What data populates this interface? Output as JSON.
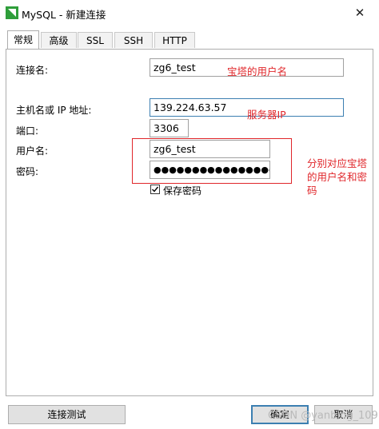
{
  "window": {
    "title": "MySQL - 新建连接",
    "close_glyph": "✕"
  },
  "tabs": [
    {
      "label": "常规",
      "active": true
    },
    {
      "label": "高级"
    },
    {
      "label": "SSL"
    },
    {
      "label": "SSH"
    },
    {
      "label": "HTTP"
    }
  ],
  "form": {
    "connection_name_label": "连接名:",
    "connection_name_value": "zg6_test",
    "host_label": "主机名或 IP 地址:",
    "host_value": "139.224.63.57",
    "port_label": "端口:",
    "port_value": "3306",
    "username_label": "用户名:",
    "username_value": "zg6_test",
    "password_label": "密码:",
    "password_value": "●●●●●●●●●●●●●●●●",
    "save_password_label": "保存密码",
    "save_password_checked": true
  },
  "annotations": {
    "connection_name_note": "宝塔的用户名",
    "host_note": "服务器IP",
    "credentials_note_line1": "分别对应宝塔",
    "credentials_note_line2": "的用户名和密",
    "credentials_note_line3": "码"
  },
  "buttons": {
    "test_connection": "连接测试",
    "ok": "确定",
    "cancel": "取消"
  },
  "watermark": "CSDN @yanbing_109",
  "colors": {
    "annotation_red": "#e0262a",
    "focus_blue": "#3c7fb1",
    "app_icon_green": "#2e9e3a"
  }
}
